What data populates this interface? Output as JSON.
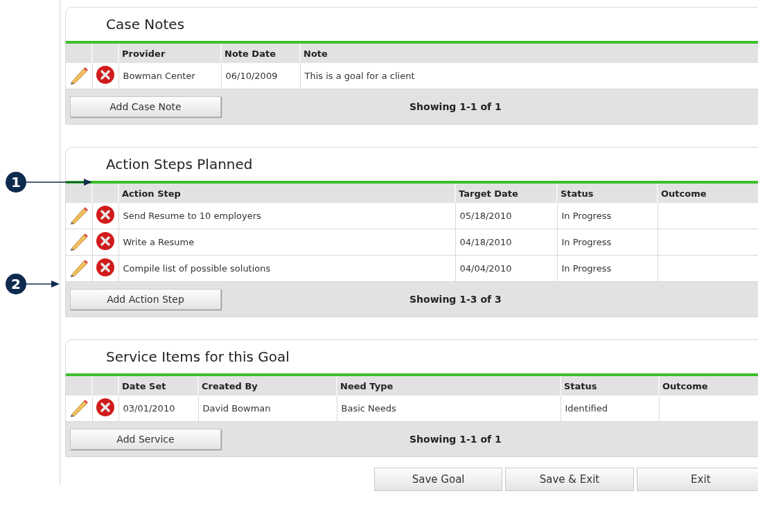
{
  "sections": [
    {
      "title": "Case Notes",
      "columns": [
        "Provider",
        "Note Date",
        "Note"
      ],
      "rows": [
        {
          "cells": [
            "Bowman Center",
            "06/10/2009",
            "This is a goal for a client"
          ]
        }
      ],
      "add_button": "Add Case Note",
      "showing": "Showing 1-1 of 1"
    },
    {
      "title": "Action Steps Planned",
      "columns": [
        "Action Step",
        "Target Date",
        "Status",
        "Outcome"
      ],
      "rows": [
        {
          "cells": [
            "Send Resume to 10 employers",
            "05/18/2010",
            "In Progress",
            ""
          ]
        },
        {
          "cells": [
            "Write a Resume",
            "04/18/2010",
            "In Progress",
            ""
          ]
        },
        {
          "cells": [
            "Compile list of possible solutions",
            "04/04/2010",
            "In Progress",
            ""
          ]
        }
      ],
      "add_button": "Add Action Step",
      "showing": "Showing 1-3 of 3"
    },
    {
      "title": "Service Items for this Goal",
      "columns": [
        "Date Set",
        "Created By",
        "Need Type",
        "Status",
        "Outcome"
      ],
      "rows": [
        {
          "cells": [
            "03/01/2010",
            "David Bowman",
            "Basic Needs",
            "Identified",
            ""
          ]
        }
      ],
      "add_button": "Add Service",
      "showing": "Showing 1-1 of 1"
    }
  ],
  "callouts": [
    {
      "label": "1"
    },
    {
      "label": "2"
    }
  ],
  "buttons": [
    "Save Goal",
    "Save & Exit",
    "Exit"
  ]
}
